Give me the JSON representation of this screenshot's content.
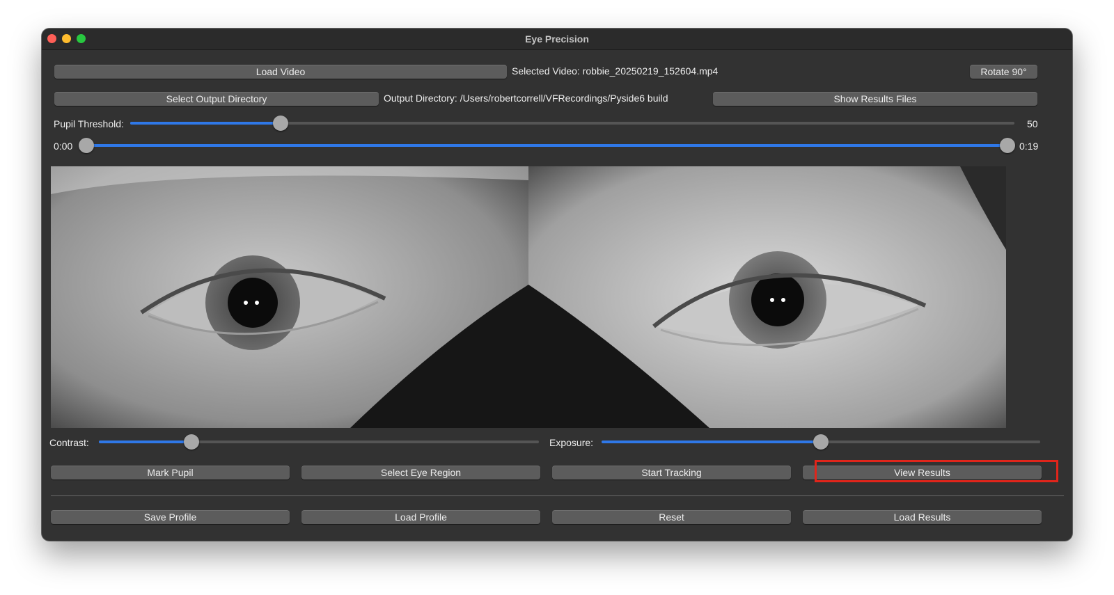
{
  "window": {
    "title": "Eye Precision"
  },
  "toolbar": {
    "load_video_label": "Load Video",
    "selected_video_text": "Selected Video: robbie_20250219_152604.mp4",
    "rotate_label": "Rotate 90°",
    "select_output_label": "Select Output Directory",
    "output_directory_text": "Output Directory: /Users/robertcorrell/VFRecordings/Pyside6 build",
    "show_results_files_label": "Show Results Files"
  },
  "pupil_threshold": {
    "label": "Pupil Threshold:",
    "value": "50",
    "fraction": 0.17
  },
  "timeline": {
    "start": "0:00",
    "end": "0:19",
    "position": 0.0
  },
  "video": {
    "description_icon": "eye-video-frame"
  },
  "adjustments": {
    "contrast_label": "Contrast:",
    "contrast_fraction": 0.21,
    "exposure_label": "Exposure:",
    "exposure_fraction": 0.5
  },
  "actions": {
    "mark_pupil": "Mark Pupil",
    "select_eye_region": "Select Eye Region",
    "start_tracking": "Start Tracking",
    "view_results": "View Results"
  },
  "profile": {
    "save_profile": "Save Profile",
    "load_profile": "Load Profile",
    "reset": "Reset",
    "load_results": "Load Results"
  },
  "colors": {
    "accent": "#2f78e8",
    "window_bg": "#323232",
    "button_bg": "#5c5c5c",
    "highlight": "#e0251b"
  }
}
